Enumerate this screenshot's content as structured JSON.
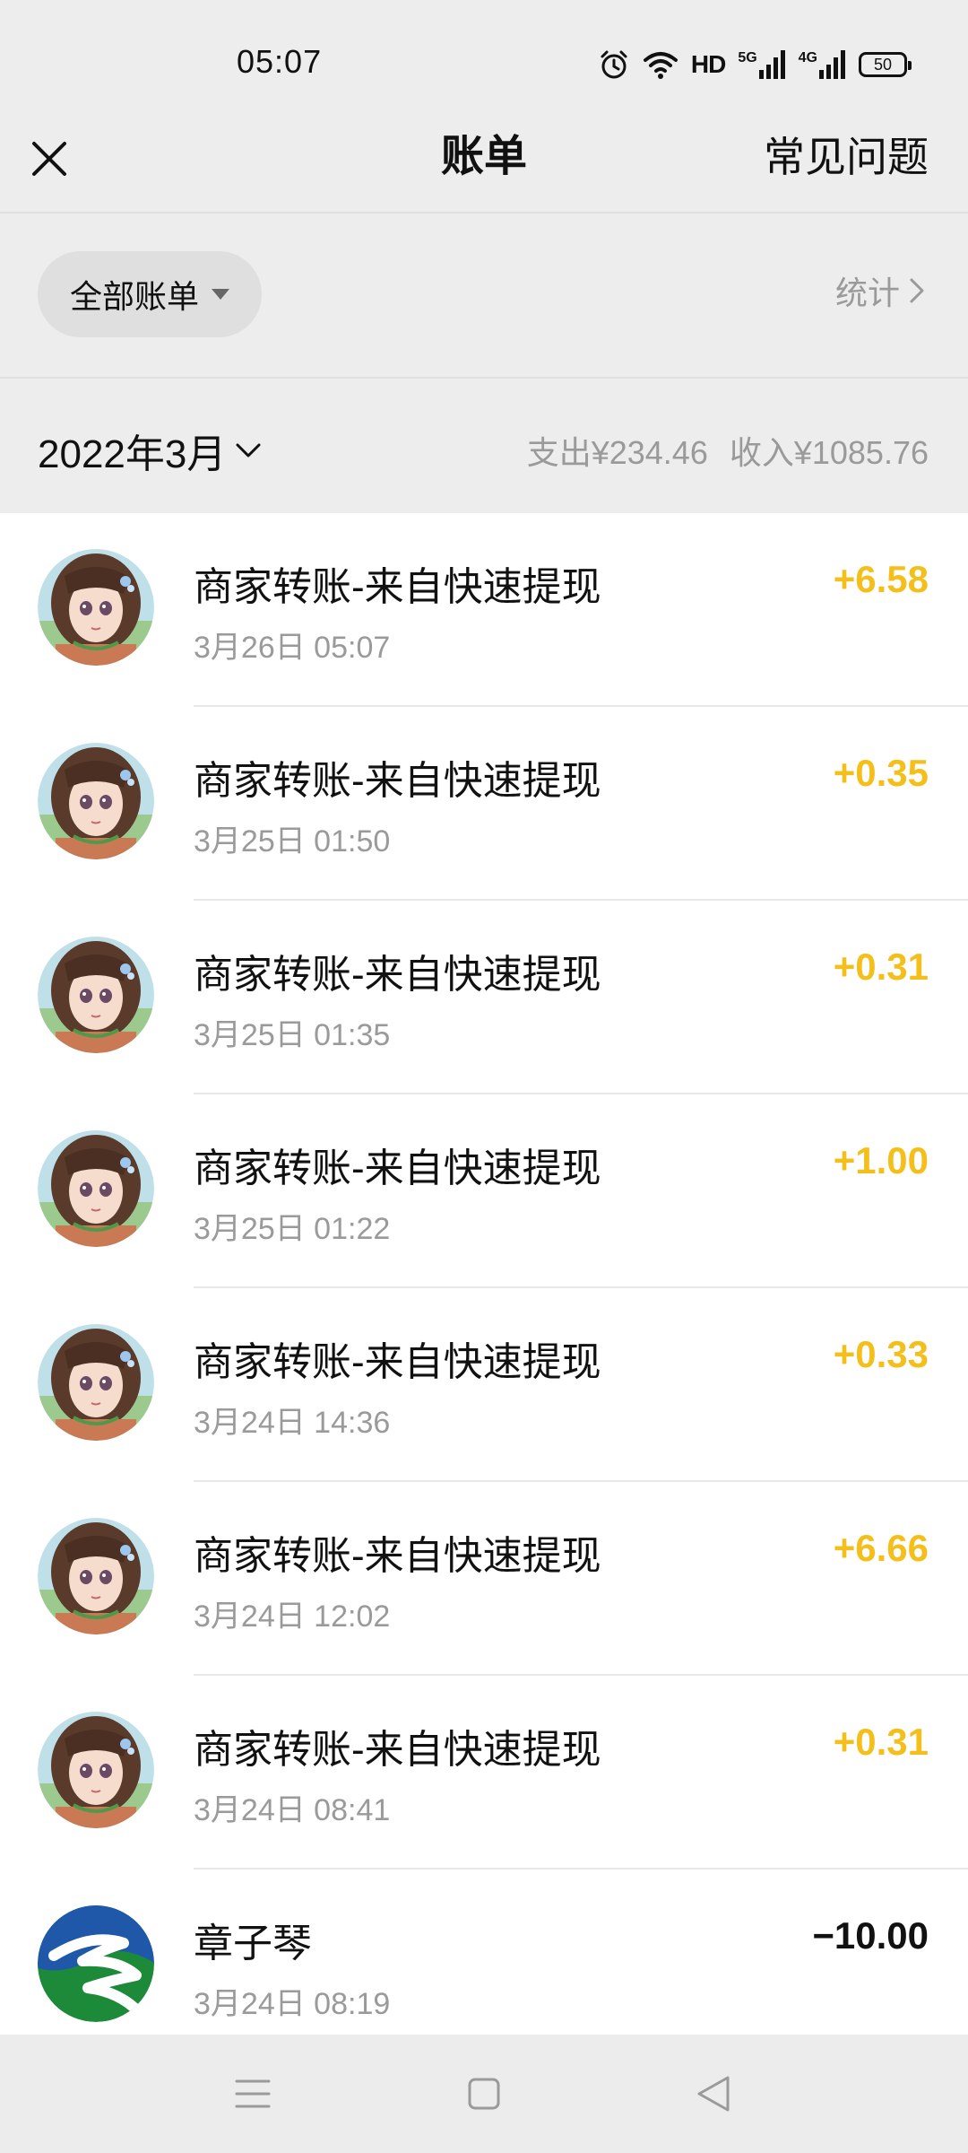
{
  "status_bar": {
    "time": "05:07",
    "network_label": "HD",
    "signal_5g": "5G",
    "signal_4g": "4G",
    "battery": "50",
    "icons": [
      "alarm-icon",
      "wifi-icon",
      "signal-5g-icon",
      "signal-4g-icon",
      "battery-icon"
    ]
  },
  "nav": {
    "title": "账单",
    "faq": "常见问题"
  },
  "filter": {
    "all_bills": "全部账单",
    "stats": "统计"
  },
  "month": {
    "label": "2022年3月",
    "expense": "支出¥234.46",
    "income": "收入¥1085.76"
  },
  "colors": {
    "income": "#f4bf1b",
    "expense": "#111111",
    "background": "#ededed"
  },
  "bills": [
    {
      "title": "商家转账-来自快速提现",
      "time": "3月26日 05:07",
      "amount": "+6.58",
      "type": "income",
      "avatar": "anime-girl-avatar"
    },
    {
      "title": "商家转账-来自快速提现",
      "time": "3月25日 01:50",
      "amount": "+0.35",
      "type": "income",
      "avatar": "anime-girl-avatar"
    },
    {
      "title": "商家转账-来自快速提现",
      "time": "3月25日 01:35",
      "amount": "+0.31",
      "type": "income",
      "avatar": "anime-girl-avatar"
    },
    {
      "title": "商家转账-来自快速提现",
      "time": "3月25日 01:22",
      "amount": "+1.00",
      "type": "income",
      "avatar": "anime-girl-avatar"
    },
    {
      "title": "商家转账-来自快速提现",
      "time": "3月24日 14:36",
      "amount": "+0.33",
      "type": "income",
      "avatar": "anime-girl-avatar"
    },
    {
      "title": "商家转账-来自快速提现",
      "time": "3月24日 12:02",
      "amount": "+6.66",
      "type": "income",
      "avatar": "anime-girl-avatar"
    },
    {
      "title": "商家转账-来自快速提现",
      "time": "3月24日 08:41",
      "amount": "+0.31",
      "type": "income",
      "avatar": "anime-girl-avatar"
    },
    {
      "title": "章子琴",
      "time": "3月24日 08:19",
      "amount": "−10.00",
      "type": "expense",
      "avatar": "road-logo-avatar"
    }
  ],
  "system_nav": [
    "menu-icon",
    "home-icon",
    "back-icon"
  ]
}
